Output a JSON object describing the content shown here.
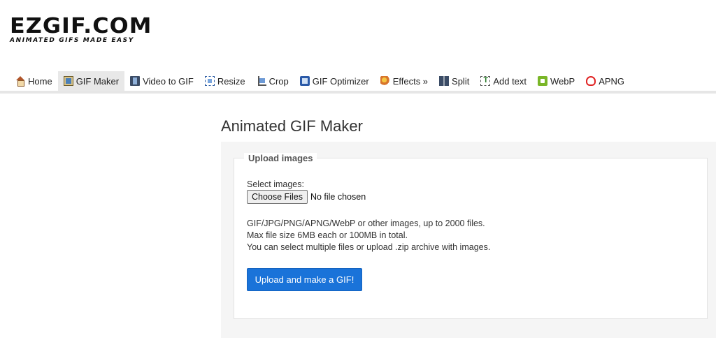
{
  "logo": {
    "main": "EZGIF.COM",
    "tagline": "ANIMATED GIFS MADE EASY"
  },
  "nav": {
    "items": [
      {
        "label": "Home",
        "icon": "home-icon"
      },
      {
        "label": "GIF Maker",
        "icon": "gif-maker-icon",
        "active": true
      },
      {
        "label": "Video to GIF",
        "icon": "video-icon"
      },
      {
        "label": "Resize",
        "icon": "resize-icon"
      },
      {
        "label": "Crop",
        "icon": "crop-icon"
      },
      {
        "label": "GIF Optimizer",
        "icon": "optimizer-icon"
      },
      {
        "label": "Effects »",
        "icon": "effects-icon"
      },
      {
        "label": "Split",
        "icon": "split-icon"
      },
      {
        "label": "Add text",
        "icon": "add-text-icon"
      },
      {
        "label": "WebP",
        "icon": "webp-icon"
      },
      {
        "label": "APNG",
        "icon": "apng-icon"
      }
    ]
  },
  "main": {
    "title": "Animated GIF Maker",
    "upload": {
      "legend": "Upload images",
      "select_label": "Select images:",
      "choose_button": "Choose Files",
      "file_status": "No file chosen",
      "info_lines": [
        "GIF/JPG/PNG/APNG/WebP or other images, up to 2000 files.",
        "Max file size 6MB each or 100MB in total.",
        "You can select multiple files or upload .zip archive with images."
      ],
      "submit_button": "Upload and make a GIF!"
    }
  },
  "colors": {
    "accent": "#1a73d9",
    "nav_active_bg": "#e8e8e8",
    "panel_bg": "#f5f5f5"
  }
}
